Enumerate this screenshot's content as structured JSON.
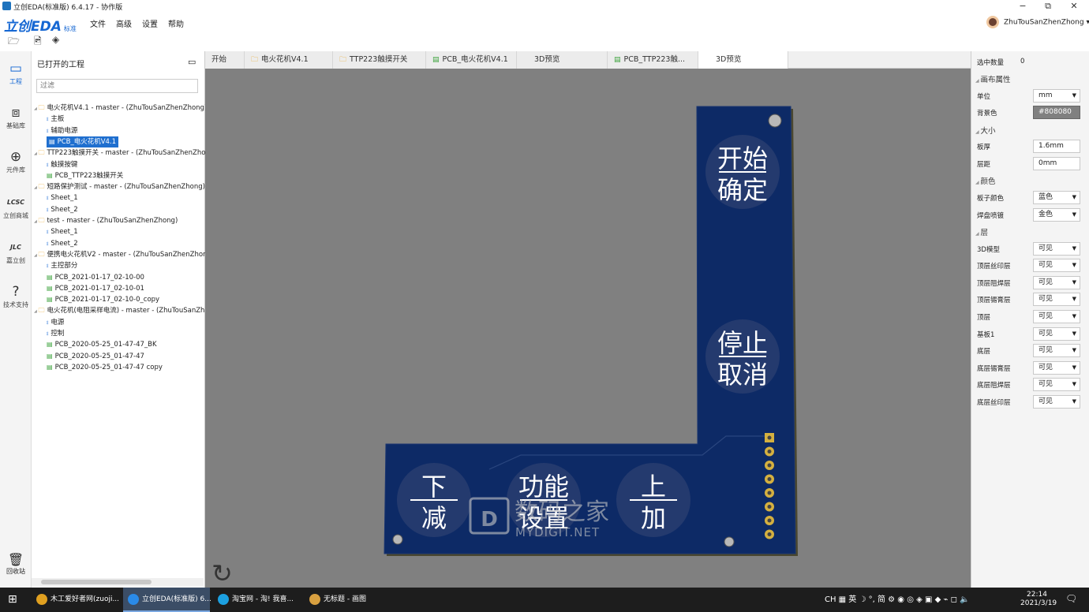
{
  "window": {
    "title": "立创EDA(标准版) 6.4.17 - 协作版",
    "minimize": "−",
    "restore": "⧉",
    "close": "✕"
  },
  "app": {
    "logo": "立创EDA",
    "edition": "标准"
  },
  "menu": [
    "文件",
    "高级",
    "设置",
    "帮助"
  ],
  "user": {
    "name": "ZhuTouSanZhenZhong ▾"
  },
  "toolbar": {
    "open": "🗁",
    "image": "🖻",
    "layers": "◈"
  },
  "left_rail": [
    {
      "label": "工程",
      "icon": "▭"
    },
    {
      "label": "基础库",
      "icon": "⧈"
    },
    {
      "label": "元件库",
      "icon": "⊕"
    },
    {
      "label": "立创商城",
      "icon": "LCSC"
    },
    {
      "label": "嘉立创",
      "icon": "JLC"
    },
    {
      "label": "技术支持",
      "icon": "?"
    }
  ],
  "recycle": {
    "label": "回收站",
    "icon": "🗑"
  },
  "project_panel": {
    "title": "已打开的工程",
    "filter_placeholder": "过滤",
    "tree": [
      {
        "text": "电火花机V4.1 - master - (ZhuTouSanZhenZhong)",
        "kind": "folder",
        "level": 0
      },
      {
        "text": "主板",
        "kind": "sch",
        "level": 1
      },
      {
        "text": "辅助电源",
        "kind": "sch",
        "level": 1
      },
      {
        "text": "PCB_电火花机V4.1",
        "kind": "pcb",
        "level": 1,
        "selected": true
      },
      {
        "text": "TTP223触摸开关 - master - (ZhuTouSanZhenZhong)",
        "kind": "folder",
        "level": 0
      },
      {
        "text": "触摸按键",
        "kind": "sch",
        "level": 1
      },
      {
        "text": "PCB_TTP223触摸开关",
        "kind": "pcb",
        "level": 1
      },
      {
        "text": "短路保护测试 - master - (ZhuTouSanZhenZhong)",
        "kind": "folder",
        "level": 0
      },
      {
        "text": "Sheet_1",
        "kind": "sch",
        "level": 1
      },
      {
        "text": "Sheet_2",
        "kind": "sch",
        "level": 1
      },
      {
        "text": "test - master - (ZhuTouSanZhenZhong)",
        "kind": "folder",
        "level": 0
      },
      {
        "text": "Sheet_1",
        "kind": "sch",
        "level": 1
      },
      {
        "text": "Sheet_2",
        "kind": "sch",
        "level": 1
      },
      {
        "text": "便携电火花机V2 - master - (ZhuTouSanZhenZhong)",
        "kind": "folder",
        "level": 0
      },
      {
        "text": "主控部分",
        "kind": "sch",
        "level": 1
      },
      {
        "text": "PCB_2021-01-17_02-10-00",
        "kind": "pcb",
        "level": 1
      },
      {
        "text": "PCB_2021-01-17_02-10-01",
        "kind": "pcb",
        "level": 1
      },
      {
        "text": "PCB_2021-01-17_02-10-0_copy",
        "kind": "pcb",
        "level": 1
      },
      {
        "text": "电火花机(电阻采样电流) - master - (ZhuTouSanZhenZhong)",
        "kind": "folder",
        "level": 0
      },
      {
        "text": "电源",
        "kind": "sch",
        "level": 1
      },
      {
        "text": "控制",
        "kind": "sch",
        "level": 1
      },
      {
        "text": "PCB_2020-05-25_01-47-47_BK",
        "kind": "pcb",
        "level": 1
      },
      {
        "text": "PCB_2020-05-25_01-47-47",
        "kind": "pcb",
        "level": 1
      },
      {
        "text": "PCB_2020-05-25_01-47-47 copy",
        "kind": "pcb",
        "level": 1
      }
    ]
  },
  "tabs": [
    {
      "label": "开始",
      "icon": ""
    },
    {
      "label": "电火花机V4.1",
      "icon": "🗀"
    },
    {
      "label": "TTP223触摸开关",
      "icon": "🗀"
    },
    {
      "label": "PCB_电火花机V4.1",
      "icon": "▤"
    },
    {
      "label": "3D预览",
      "icon": ""
    },
    {
      "label": "PCB_TTP223触...",
      "icon": "▤"
    },
    {
      "label": "3D预览",
      "icon": "",
      "active": true
    }
  ],
  "board": {
    "color": "#0d2a66",
    "buttons": [
      {
        "top": "开始",
        "bottom": "确定"
      },
      {
        "top": "停止",
        "bottom": "取消"
      },
      {
        "top": "下",
        "bottom": "减"
      },
      {
        "top": "功能",
        "bottom": "设置"
      },
      {
        "top": "上",
        "bottom": "加"
      }
    ],
    "watermark_cn": "数码之家",
    "watermark_en": "MYDIGIT.NET"
  },
  "reload_icon": "↻",
  "right_panel": {
    "selected_count_label": "选中数量",
    "selected_count": "0",
    "sections": [
      {
        "title": "画布属性",
        "rows": [
          {
            "label": "单位",
            "value": "mm",
            "type": "select"
          },
          {
            "label": "背景色",
            "value": "#808080",
            "type": "color"
          }
        ]
      },
      {
        "title": "大小",
        "rows": [
          {
            "label": "板厚",
            "value": "1.6mm",
            "type": "input"
          },
          {
            "label": "层距",
            "value": "0mm",
            "type": "input"
          }
        ]
      },
      {
        "title": "颜色",
        "rows": [
          {
            "label": "板子颜色",
            "value": "蓝色",
            "type": "select"
          },
          {
            "label": "焊盘喷镀",
            "value": "金色",
            "type": "select"
          }
        ]
      },
      {
        "title": "层",
        "rows": [
          {
            "label": "3D模型",
            "value": "可见",
            "type": "select"
          },
          {
            "label": "顶层丝印层",
            "value": "可见",
            "type": "select"
          },
          {
            "label": "顶层阻焊层",
            "value": "可见",
            "type": "select"
          },
          {
            "label": "顶层锡膏层",
            "value": "可见",
            "type": "select"
          },
          {
            "label": "顶层",
            "value": "可见",
            "type": "select"
          },
          {
            "label": "基板1",
            "value": "可见",
            "type": "select"
          },
          {
            "label": "底层",
            "value": "可见",
            "type": "select"
          },
          {
            "label": "底层锡膏层",
            "value": "可见",
            "type": "select"
          },
          {
            "label": "底层阻焊层",
            "value": "可见",
            "type": "select"
          },
          {
            "label": "底层丝印层",
            "value": "可见",
            "type": "select"
          }
        ]
      }
    ]
  },
  "taskbar": {
    "start_icon": "⊞",
    "items": [
      {
        "label": "木工爱好者网(zuoji...",
        "color": "#e0a020"
      },
      {
        "label": "立创EDA(标准版) 6...",
        "color": "#2a8ae8"
      },
      {
        "label": "淘宝网 - 淘! 我喜...",
        "color": "#1ca0e0"
      },
      {
        "label": "无标题 - 画图",
        "color": "#d8a040"
      }
    ],
    "tray": "CH ▦ 英 ☽ °, 简 ⚙ ◉ ◎ ◈ ▣ ◆ ⌁ ◻ 🔈",
    "time": "22:14",
    "date": "2021/3/19",
    "notification_icon": "🗨"
  }
}
